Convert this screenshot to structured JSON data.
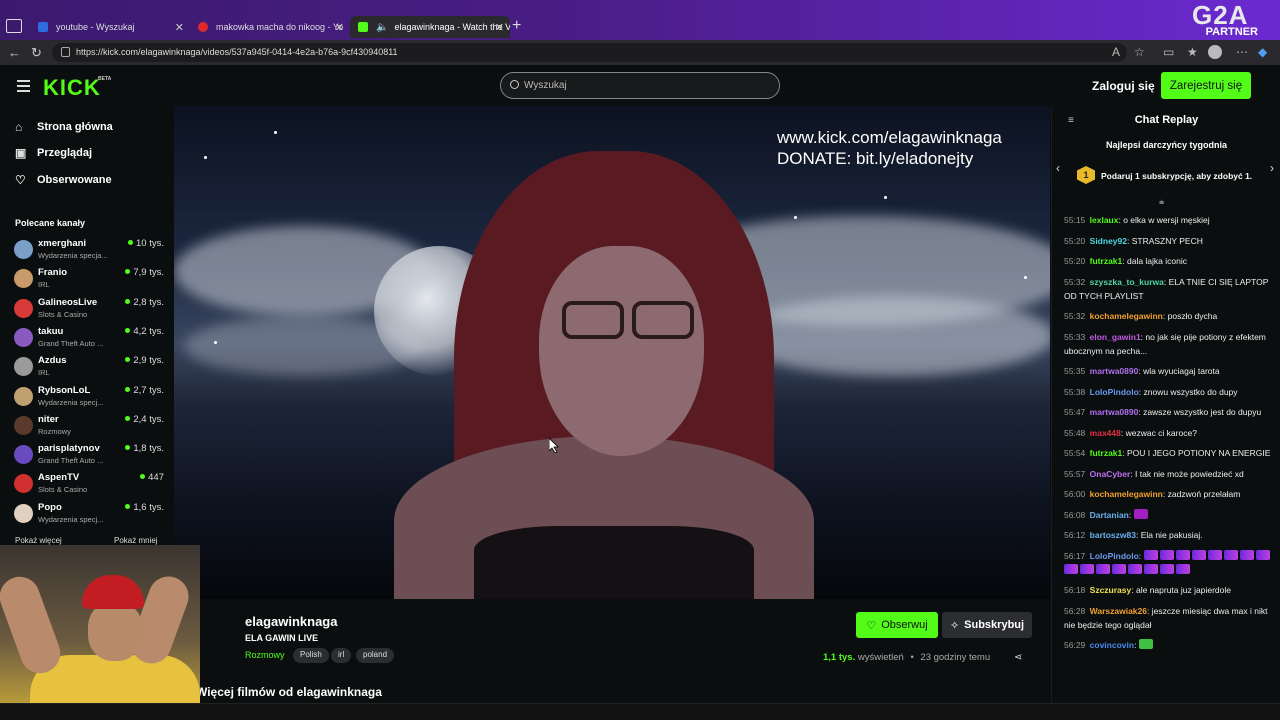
{
  "browser": {
    "tabs": [
      {
        "label": "youtube - Wyszukaj",
        "color": "#2d6cdf"
      },
      {
        "label": "makowka macha do nikoog - Yo",
        "color": "#e02a2a"
      },
      {
        "label": "elagawinknaga - Watch the V",
        "color": "#53fc18"
      }
    ],
    "url": "https://kick.com/elagawinknaga/videos/537a945f-0414-4e2a-b76a-9cf430940811",
    "overlay_logo": "G2A",
    "overlay_partner": "PARTNER"
  },
  "header": {
    "logo": "KICK",
    "beta": "BETA",
    "search_placeholder": "Wyszukaj",
    "login": "Zaloguj się",
    "register": "Zarejestruj się"
  },
  "sidebar": {
    "nav": [
      {
        "label": "Strona główna",
        "icon": "home-icon"
      },
      {
        "label": "Przeglądaj",
        "icon": "browse-icon"
      },
      {
        "label": "Obserwowane",
        "icon": "heart-icon"
      }
    ],
    "recommended_title": "Polecane kanały",
    "channels": [
      {
        "name": "xmerghani",
        "category": "Wydarzenia specja...",
        "viewers": "10 tys.",
        "color": "#7aa0c8"
      },
      {
        "name": "Franio",
        "category": "IRL",
        "viewers": "7,9 tys.",
        "color": "#c89a6a"
      },
      {
        "name": "GalineosLive",
        "category": "Slots & Casino",
        "viewers": "2,8 tys.",
        "color": "#d83a3a"
      },
      {
        "name": "takuu",
        "category": "Grand Theft Auto ...",
        "viewers": "4,2 tys.",
        "color": "#8a5ac0"
      },
      {
        "name": "Azdus",
        "category": "IRL",
        "viewers": "2,9 tys.",
        "color": "#9a9a9a"
      },
      {
        "name": "RybsonLoL",
        "category": "Wydarzenia specj...",
        "viewers": "2,7 tys.",
        "color": "#c0a070"
      },
      {
        "name": "niter",
        "category": "Rozmowy",
        "viewers": "2,4 tys.",
        "color": "#5a3a2a"
      },
      {
        "name": "parisplatynov",
        "category": "Grand Theft Auto ...",
        "viewers": "1,8 tys.",
        "color": "#6a4ac0"
      },
      {
        "name": "AspenTV",
        "category": "Slots & Casino",
        "viewers": "447",
        "color": "#d03030"
      },
      {
        "name": "Popo",
        "category": "Wydarzenia specj...",
        "viewers": "1,6 tys.",
        "color": "#e0d0c0"
      }
    ],
    "show_more": "Pokaż więcej",
    "show_less": "Pokaż mniej"
  },
  "video": {
    "overlay_line1": "www.kick.com/elagawinknaga",
    "overlay_line2": "DONATE: bit.ly/eladonejty"
  },
  "stream_info": {
    "channel": "elagawinknaga",
    "title": "ELA GAWIN LIVE",
    "category": "Rozmowy",
    "tags": [
      "Polish",
      "irl",
      "poland"
    ],
    "follow": "Obserwuj",
    "subscribe": "Subskrybuj",
    "views_count": "1,1 tys.",
    "views_label": "wyświetleń",
    "ago": "23 godziny temu",
    "more_videos": "Więcej filmów od elagawinknaga"
  },
  "chat": {
    "title": "Chat Replay",
    "top_gifters": "Najlepsi darczyńcy tygodnia",
    "badge_num": "1",
    "promo": "Podaruj 1 subskrypcję, aby zdobyć 1.",
    "messages": [
      {
        "time": "55:15",
        "user": "lexlaux",
        "color": "#53fc18",
        "text": "o elka w wersji męskiej"
      },
      {
        "time": "55:20",
        "user": "Sidney92",
        "color": "#4fd6e0",
        "text": "STRASZNY PECH"
      },
      {
        "time": "55:20",
        "user": "futrzak1",
        "color": "#53fc18",
        "text": "dala lajka iconic"
      },
      {
        "time": "55:32",
        "user": "szyszka_to_kurwa",
        "color": "#4fd6a0",
        "text": "ELA TNIE CI SIĘ LAPTOP OD TYCH PLAYLIST"
      },
      {
        "time": "55:32",
        "user": "kochamelegawinn",
        "color": "#f0a030",
        "text": "poszło dycha"
      },
      {
        "time": "55:33",
        "user": "elon_gawin1",
        "color": "#c05ae0",
        "text": "no jak się pije potiony z efektem ubocznym na pecha..."
      },
      {
        "time": "55:35",
        "user": "martwa0890",
        "color": "#b070f0",
        "text": "wla wyuciagaj tarota"
      },
      {
        "time": "55:38",
        "user": "LoloPindolo",
        "color": "#6a9af0",
        "text": "znowu wszystko do dupy"
      },
      {
        "time": "55:47",
        "user": "martwa0890",
        "color": "#b070f0",
        "text": "zawsze wszystko jest do dupyu"
      },
      {
        "time": "55:48",
        "user": "max448",
        "color": "#e03040",
        "text": "wezwac ci karoce?"
      },
      {
        "time": "55:54",
        "user": "futrzak1",
        "color": "#53fc18",
        "text": "POU I JEGO POTIONY NA ENERGIE"
      },
      {
        "time": "55:57",
        "user": "OnaCyber",
        "color": "#c070f0",
        "text": "I tak nie może powiedzieć xd"
      },
      {
        "time": "56:00",
        "user": "kochamelegawinn",
        "color": "#f0a030",
        "text": "zadzwoń przelałam"
      },
      {
        "time": "56:08",
        "user": "Dartanian",
        "color": "#6ab0f0",
        "text": ""
      },
      {
        "time": "56:12",
        "user": "bartoszw83",
        "color": "#6ab0f0",
        "text": "Ela nie pakusiaj."
      },
      {
        "time": "56:17",
        "user": "LoloPindolo",
        "color": "#6a9af0",
        "text": ""
      },
      {
        "time": "56:18",
        "user": "Szczurasy",
        "color": "#f0e050",
        "text": "ale napruta juz japierdole"
      },
      {
        "time": "56:28",
        "user": "Warszawiak26",
        "color": "#f0a030",
        "text": "jeszcze miesiąc dwa max i nikt nie będzie tego oglądał"
      },
      {
        "time": "56:29",
        "user": "covincovin",
        "color": "#4a8af0",
        "text": ""
      }
    ]
  }
}
